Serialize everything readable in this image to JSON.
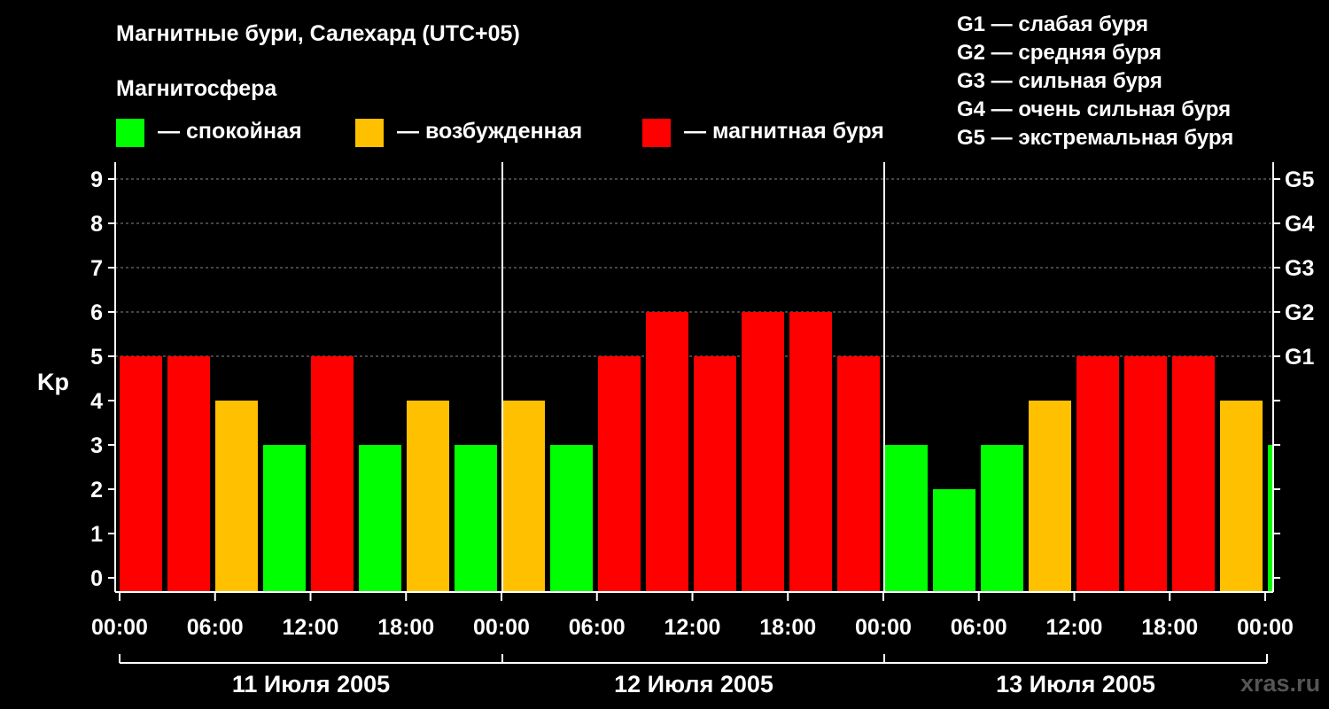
{
  "chart_data": {
    "type": "bar",
    "title": "Магнитные бури, Салехард (UTC+05)",
    "legend_heading": "Магнитосфера",
    "legend": [
      {
        "label": "— спокойная",
        "color": "#00ff00"
      },
      {
        "label": "— возбужденная",
        "color": "#ffc000"
      },
      {
        "label": "— магнитная буря",
        "color": "#ff0000"
      }
    ],
    "storm_scale": [
      "G1 — слабая буря",
      "G2 — средняя буря",
      "G3 — сильная буря",
      "G4 — очень сильная буря",
      "G5 — экстремальная буря"
    ],
    "ylabel": "Kp",
    "ylim": [
      0,
      9
    ],
    "y_ticks": [
      "0",
      "1",
      "2",
      "3",
      "4",
      "5",
      "6",
      "7",
      "8",
      "9"
    ],
    "right_ticks": [
      {
        "value": 5,
        "label": "G1"
      },
      {
        "value": 6,
        "label": "G2"
      },
      {
        "value": 7,
        "label": "G3"
      },
      {
        "value": 8,
        "label": "G4"
      },
      {
        "value": 9,
        "label": "G5"
      }
    ],
    "x_tick_labels": [
      "00:00",
      "06:00",
      "12:00",
      "18:00",
      "00:00",
      "06:00",
      "12:00",
      "18:00",
      "00:00",
      "06:00",
      "12:00",
      "18:00",
      "00:00"
    ],
    "days": [
      "11 Июля 2005",
      "12 Июля 2005",
      "13 Июля 2005"
    ],
    "interval_hours": 3,
    "values": [
      5,
      5,
      4,
      3,
      5,
      3,
      4,
      3,
      4,
      3,
      5,
      6,
      5,
      6,
      6,
      5,
      3,
      2,
      3,
      4,
      5,
      5,
      5,
      4,
      3
    ],
    "grid": true,
    "colors": {
      "quiet": "#00ff00",
      "active": "#ffc000",
      "storm": "#ff0000",
      "grid": "#888888",
      "axis": "#ffffff",
      "background": "#000000"
    }
  },
  "watermark": "xras.ru"
}
